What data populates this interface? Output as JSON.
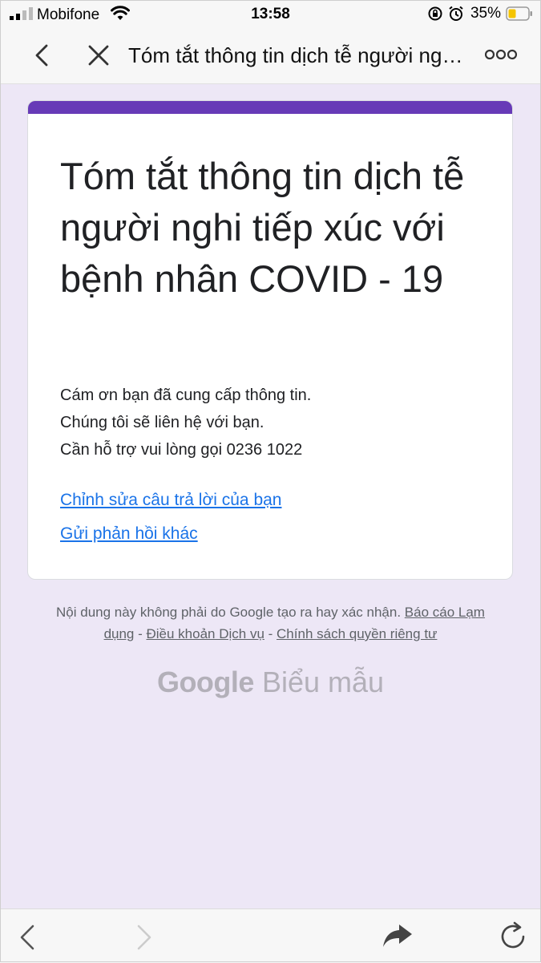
{
  "status_bar": {
    "carrier": "Mobifone",
    "time": "13:58",
    "battery": "35%"
  },
  "nav": {
    "title": "Tóm tắt thông tin dịch tễ người nghi tiếp xúc với bệnh nhân COVID - 19"
  },
  "form": {
    "title": "Tóm tắt thông tin dịch tễ người nghi tiếp xúc với bệnh nhân COVID - 19",
    "message_lines": [
      "Cám ơn bạn đã cung cấp thông tin.",
      "Chúng tôi sẽ liên hệ với bạn.",
      "Cần hỗ trợ vui lòng gọi 0236 1022"
    ],
    "edit_link": "Chỉnh sửa câu trả lời của bạn",
    "another_link": "Gửi phản hồi khác"
  },
  "footer": {
    "disclaimer": "Nội dung này không phải do Google tạo ra hay xác nhận.",
    "report_abuse": "Báo cáo Lạm dụng",
    "terms": "Điều khoản Dịch vụ",
    "privacy": "Chính sách quyền riêng tư",
    "separator": " - ",
    "logo_google": "Google",
    "logo_forms": "Biểu mẫu"
  },
  "colors": {
    "accent": "#673ab7",
    "background": "#ede7f6",
    "link": "#1a73e8"
  }
}
